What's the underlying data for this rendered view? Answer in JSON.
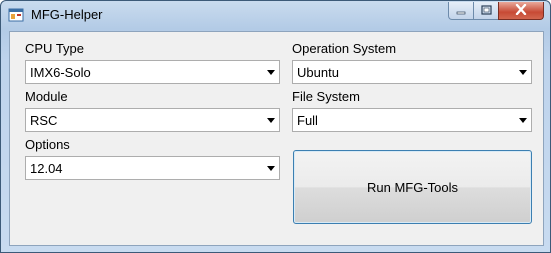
{
  "window": {
    "title": "MFG-Helper"
  },
  "form": {
    "cpu_type": {
      "label": "CPU Type",
      "value": "IMX6-Solo"
    },
    "operation_system": {
      "label": "Operation System",
      "value": "Ubuntu"
    },
    "module": {
      "label": "Module",
      "value": "RSC"
    },
    "file_system": {
      "label": "File System",
      "value": "Full"
    },
    "options": {
      "label": "Options",
      "value": "12.04"
    },
    "run_button": {
      "label": "Run MFG-Tools"
    }
  },
  "icons": {
    "app": "app-window-icon",
    "minimize": "minimize-icon",
    "maximize": "maximize-icon",
    "close": "close-icon",
    "dropdown": "chevron-down-icon"
  },
  "colors": {
    "accent": "#3c7fb1",
    "close": "#c74a35",
    "client_bg": "#f0f0f0"
  }
}
